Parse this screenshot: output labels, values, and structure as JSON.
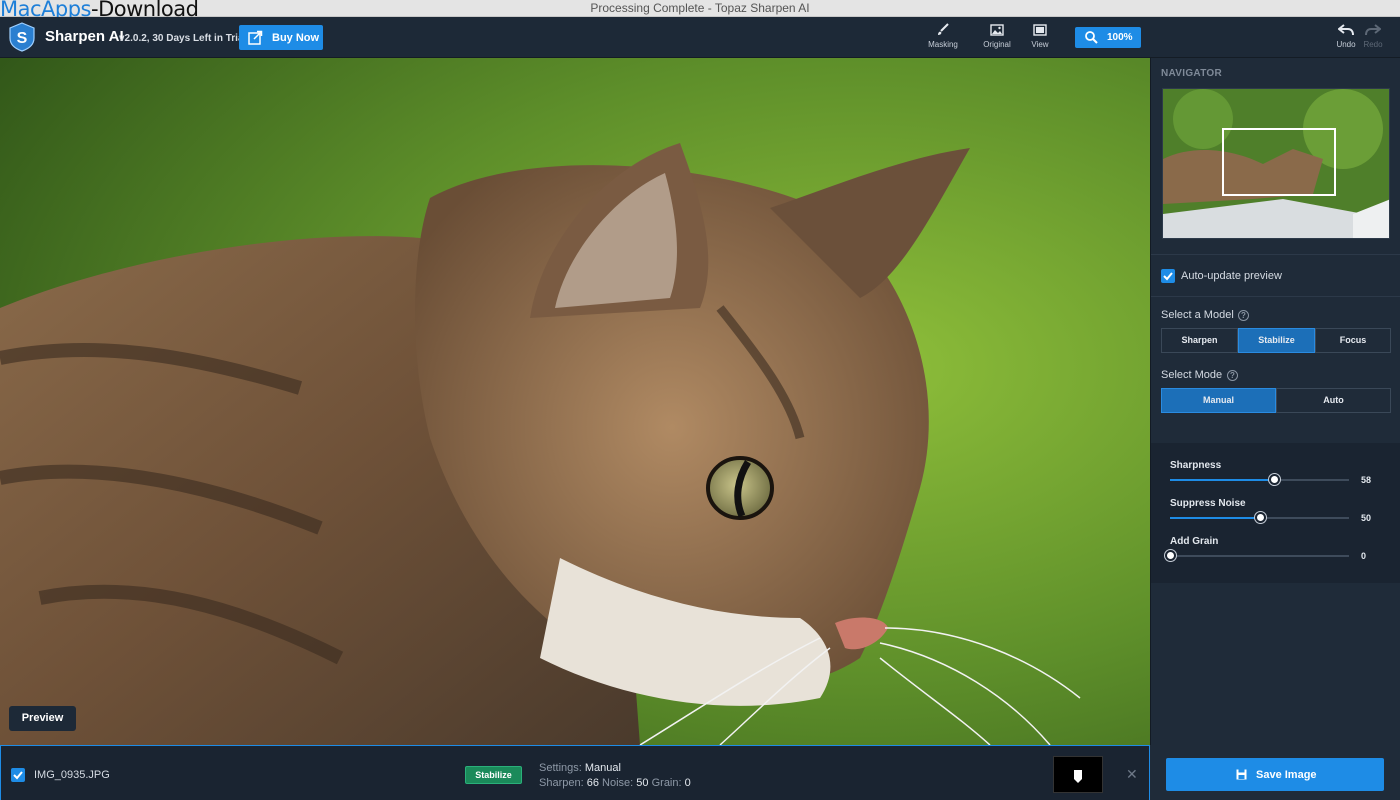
{
  "window": {
    "title": "Processing Complete - Topaz Sharpen AI",
    "watermark_a": "MacApps",
    "watermark_b": "-Download"
  },
  "app": {
    "name": "Sharpen AI",
    "version": "v2.0.2, 30 Days Left in Trial",
    "buy_label": "Buy Now"
  },
  "toolbar": {
    "masking": "Masking",
    "original": "Original",
    "view": "View",
    "zoom": "100%",
    "undo": "Undo",
    "redo": "Redo"
  },
  "canvas": {
    "preview_label": "Preview"
  },
  "navigator": {
    "title": "NAVIGATOR"
  },
  "options": {
    "auto_update": "Auto-update preview",
    "model_label": "Select a Model",
    "models": [
      "Sharpen",
      "Stabilize",
      "Focus"
    ],
    "selected_model": "Stabilize",
    "mode_label": "Select Mode",
    "modes": [
      "Manual",
      "Auto"
    ],
    "selected_mode": "Manual"
  },
  "sliders": [
    {
      "label": "Sharpness",
      "value": 58,
      "fraction": 0.58
    },
    {
      "label": "Suppress Noise",
      "value": 50,
      "fraction": 0.5
    },
    {
      "label": "Add Grain",
      "value": 0,
      "fraction": 0.0
    }
  ],
  "file": {
    "name": "IMG_0935.JPG",
    "model_badge": "Stabilize",
    "settings_label": "Settings:",
    "settings_value": "Manual",
    "sharpen_label": "Sharpen:",
    "sharpen_value": "66",
    "noise_label": "Noise:",
    "noise_value": "50",
    "grain_label": "Grain:",
    "grain_value": "0"
  },
  "save_label": "Save Image",
  "colors": {
    "accent": "#1e8ce6",
    "badge": "#1b8a5a",
    "panel": "#1f2b39"
  }
}
